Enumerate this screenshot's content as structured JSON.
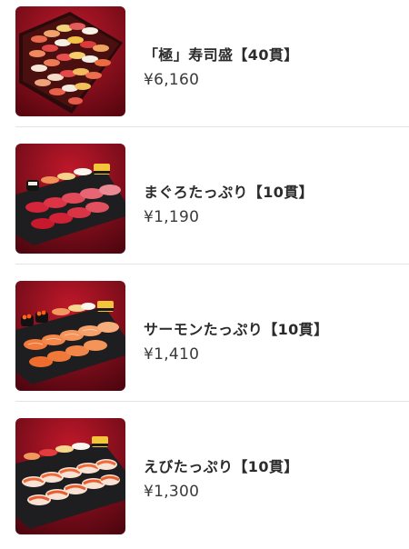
{
  "menu": {
    "items": [
      {
        "name": "「極」寿司盛【40貫】",
        "price": "¥6,160",
        "image_icon": "sushi-platter-40-icon"
      },
      {
        "name": "まぐろたっぷり【10貫】",
        "price": "¥1,190",
        "image_icon": "tuna-sushi-plate-icon"
      },
      {
        "name": "サーモンたっぷり【10貫】",
        "price": "¥1,410",
        "image_icon": "salmon-sushi-plate-icon"
      },
      {
        "name": "えびたっぷり【10貫】",
        "price": "¥1,300",
        "image_icon": "shrimp-sushi-plate-icon"
      }
    ]
  },
  "colors": {
    "background": "#ffffff",
    "photo_backdrop": "#9b0f1e",
    "divider": "#e4e4e4",
    "text": "#2b2b2b"
  }
}
